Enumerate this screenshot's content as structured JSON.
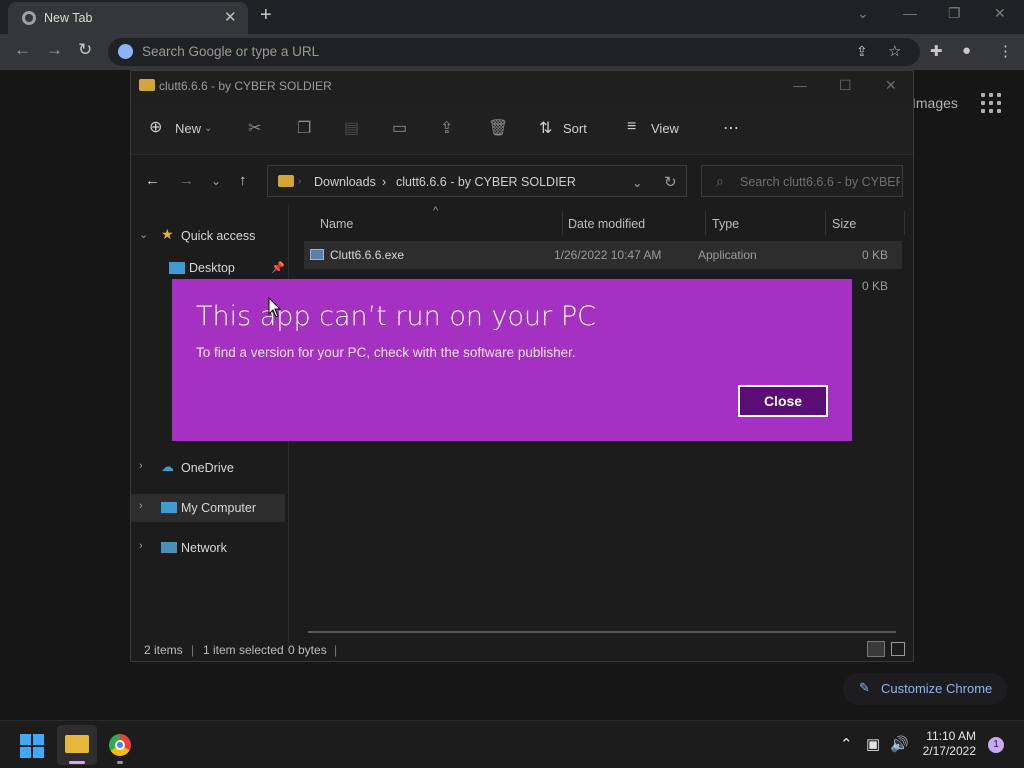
{
  "browser": {
    "tab_title": "New Tab",
    "omnibox_placeholder": "Search Google or type a URL",
    "images_link": "Images",
    "customize_label": "Customize Chrome"
  },
  "explorer": {
    "window_title": "clutt6.6.6 - by CYBER SOLDIER",
    "toolbar": {
      "new_label": "New",
      "sort_label": "Sort",
      "view_label": "View"
    },
    "address": {
      "crumbs": [
        "Downloads",
        "clutt6.6.6 - by CYBER SOLDIER"
      ],
      "search_placeholder": "Search clutt6.6.6 - by CYBER ..."
    },
    "sidebar": {
      "quick_access": "Quick access",
      "desktop": "Desktop",
      "onedrive": "OneDrive",
      "my_computer": "My Computer",
      "network": "Network"
    },
    "columns": {
      "name": "Name",
      "date": "Date modified",
      "type": "Type",
      "size": "Size"
    },
    "files": [
      {
        "name": "Clutt6.6.6.exe",
        "date": "1/26/2022 10:47 AM",
        "type": "Application",
        "size": "0 KB"
      },
      {
        "name": "",
        "date": "",
        "type": "",
        "size": "0 KB"
      }
    ],
    "status": {
      "items": "2 items",
      "selected": "1 item selected",
      "bytes": "0 bytes"
    }
  },
  "dialog": {
    "heading": "This app can’t run on your PC",
    "message": "To find a version for your PC, check with the software publisher.",
    "close_label": "Close",
    "color": "#a431c2"
  },
  "taskbar": {
    "time": "11:10 AM",
    "date": "2/17/2022",
    "notification_count": "1"
  }
}
